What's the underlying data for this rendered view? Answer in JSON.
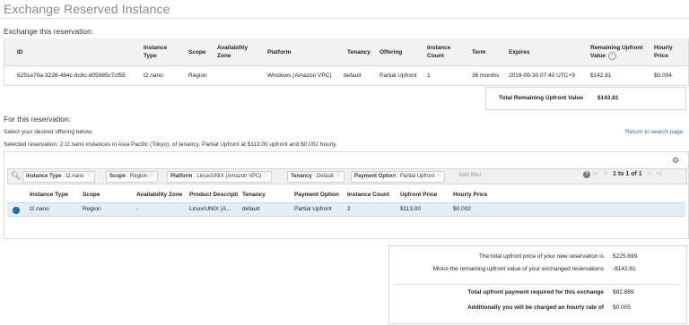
{
  "page_title": "Exchange Reserved Instance",
  "exchange_section_title": "Exchange this reservation:",
  "current_table": {
    "headers": {
      "id": "ID",
      "instance_type": "Instance Type",
      "scope": "Scope",
      "availability_zone": "Availability Zone",
      "platform": "Platform",
      "tenancy": "Tenancy",
      "offering": "Offering",
      "instance_count": "Instance Count",
      "term": "Term",
      "expires": "Expires",
      "remaining_upfront": "Remaining Upfront Value",
      "hourly_price": "Hourly Price"
    },
    "row": {
      "id": "6251e70a-3226-484c-8c8c-d05985c7cf55",
      "instance_type": "t2.nano",
      "scope": "Region",
      "availability_zone": "",
      "platform": "Windows (Amazon VPC)",
      "tenancy": "default",
      "offering": "Partial Upfront",
      "instance_count": "1",
      "term": "36 months",
      "expires": "2019-09-30 07:40 UTC+9",
      "remaining_upfront": "$142.81",
      "hourly_price": "$0.004"
    }
  },
  "total_remaining": {
    "label": "Total Remaining Upfront Value",
    "value": "$142.81"
  },
  "for_section_title": "For this reservation:",
  "select_prompt": "Select your desired offering below.",
  "return_link": "Return to search page",
  "selected_text": "Selected reservation: 2 t2.nano instances in Asia Pacific (Tokyo), of tenancy, Partial Upfront at $113.00 upfront and $0.002 hourly.",
  "filters": [
    {
      "key": "Instance Type",
      "value": "t2.nano"
    },
    {
      "key": "Scope",
      "value": "Region"
    },
    {
      "key": "Platform",
      "value": "Linux/UNIX (Amazon VPC)"
    },
    {
      "key": "Tenancy",
      "value": "Default"
    },
    {
      "key": "Payment Option",
      "value": "Partial Upfront"
    }
  ],
  "add_filter_placeholder": "Add filter",
  "pager_text": "1 to 1 of 1",
  "offering_table": {
    "headers": {
      "instance_type": "Instance Type",
      "scope": "Scope",
      "availability_zone": "Availability Zone",
      "product_description": "Product Description",
      "tenancy": "Tenancy",
      "payment_option": "Payment Option",
      "instance_count": "Instance Count",
      "upfront_price": "Upfront Price",
      "hourly_price": "Hourly Price"
    },
    "row": {
      "instance_type": "t2.nano",
      "scope": "Region",
      "availability_zone": "-",
      "product_description": "Linux/UNIX (A...",
      "tenancy": "default",
      "payment_option": "Partial Upfront",
      "instance_count": "2",
      "upfront_price": "$113.00",
      "hourly_price": "$0.002"
    }
  },
  "summary": {
    "total_new_label": "The total upfront price of your new reservation is",
    "total_new_value": "$225.699",
    "minus_label": "Minus the remaining upfront value of your exchanged reservations",
    "minus_value": "-$142.81",
    "required_label": "Total upfront payment required for this exchange",
    "required_value": "$82.889",
    "hourly_label": "Additionally you will be charged an hourly rate of",
    "hourly_value": "$0.005"
  },
  "colors": {
    "link": "#1f73b7",
    "selected_row": "#e4eef8",
    "radio": "#1f73b7"
  }
}
